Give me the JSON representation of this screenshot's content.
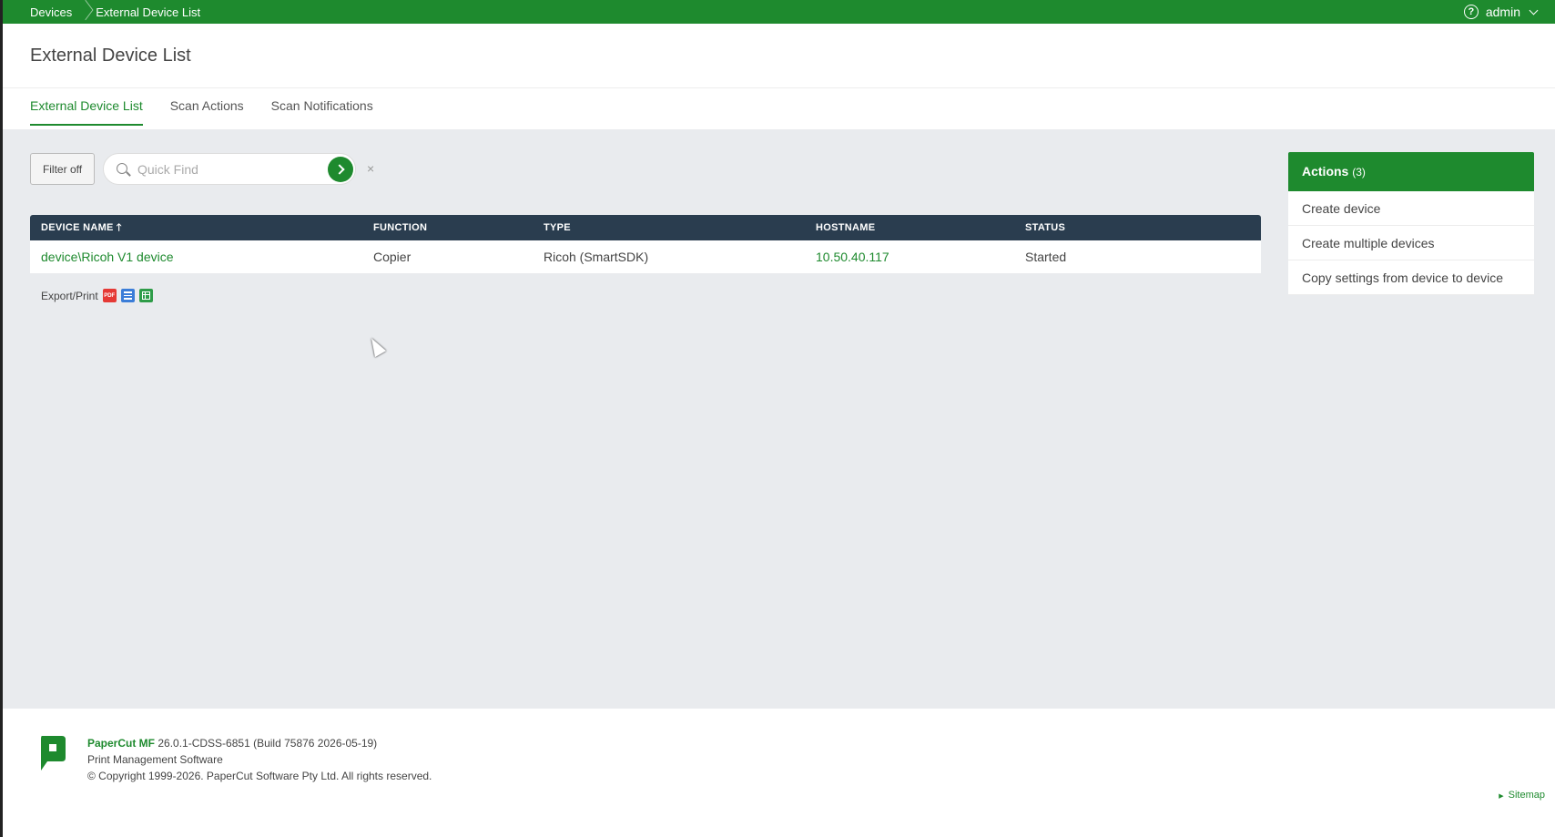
{
  "topbar": {
    "breadcrumbs": [
      "Devices",
      "External Device List"
    ],
    "user": "admin"
  },
  "header": {
    "title": "External Device List",
    "tabs": [
      {
        "label": "External Device List",
        "active": true
      },
      {
        "label": "Scan Actions",
        "active": false
      },
      {
        "label": "Scan Notifications",
        "active": false
      }
    ]
  },
  "filter": {
    "button_label": "Filter off",
    "search_placeholder": "Quick Find",
    "search_value": "",
    "clear_label": "×"
  },
  "table": {
    "columns": [
      "DEVICE NAME",
      "FUNCTION",
      "TYPE",
      "HOSTNAME",
      "STATUS"
    ],
    "sorted_column": "DEVICE NAME",
    "sort_direction": "ascending",
    "sort_glyph": "🡑",
    "rows": [
      {
        "device_name": "device\\Ricoh V1 device",
        "function": "Copier",
        "type": "Ricoh (SmartSDK)",
        "hostname": "10.50.40.117",
        "status": "Started"
      }
    ]
  },
  "export": {
    "label": "Export/Print",
    "pdf_icon_text": "PDF"
  },
  "actions": {
    "title": "Actions",
    "count": "(3)",
    "items": [
      "Create device",
      "Create multiple devices",
      "Copy settings from device to device"
    ]
  },
  "footer": {
    "product": "PaperCut MF",
    "version": "26.0.1-CDSS-6851 (Build 75876 2026-05-19)",
    "subtitle": "Print Management Software",
    "copyright": "© Copyright 1999-2026. PaperCut Software Pty Ltd. All rights reserved.",
    "sitemap": "Sitemap"
  },
  "colors": {
    "brand_green": "#1e8a2e",
    "table_header": "#2a3d4f",
    "background": "#e9ebee"
  },
  "icons": {
    "help": "help-icon",
    "user_menu": "chevron-down-icon",
    "search": "search-icon",
    "go": "arrow-right-icon",
    "clear": "close-icon",
    "pdf": "pdf-icon",
    "html": "html-icon",
    "csv": "csv-icon",
    "logo": "papercut-logo"
  }
}
